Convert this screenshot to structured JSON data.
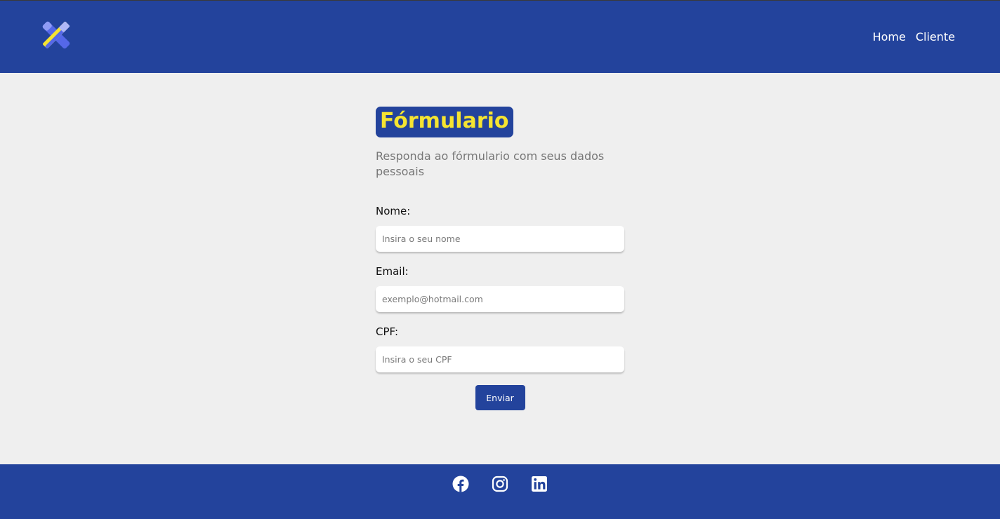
{
  "header": {
    "logo_name": "pencil-ruler-logo",
    "nav": [
      {
        "label": "Home"
      },
      {
        "label": "Cliente"
      }
    ]
  },
  "form": {
    "title": "Fórmulario",
    "subtitle": "Responda ao fórmulario com seus dados pessoais",
    "fields": [
      {
        "label": "Nome:",
        "value": "",
        "placeholder": "Insira o seu nome"
      },
      {
        "label": "Email:",
        "value": "",
        "placeholder": "exemplo@hotmail.com"
      },
      {
        "label": "CPF:",
        "value": "",
        "placeholder": "Insira o seu CPF"
      }
    ],
    "submit_label": "Enviar"
  },
  "footer": {
    "social_icons": [
      "facebook-icon",
      "instagram-icon",
      "linkedin-icon"
    ]
  },
  "colors": {
    "brand_blue": "#23439c",
    "title_yellow": "#f5e431",
    "page_bg": "#efefef"
  }
}
